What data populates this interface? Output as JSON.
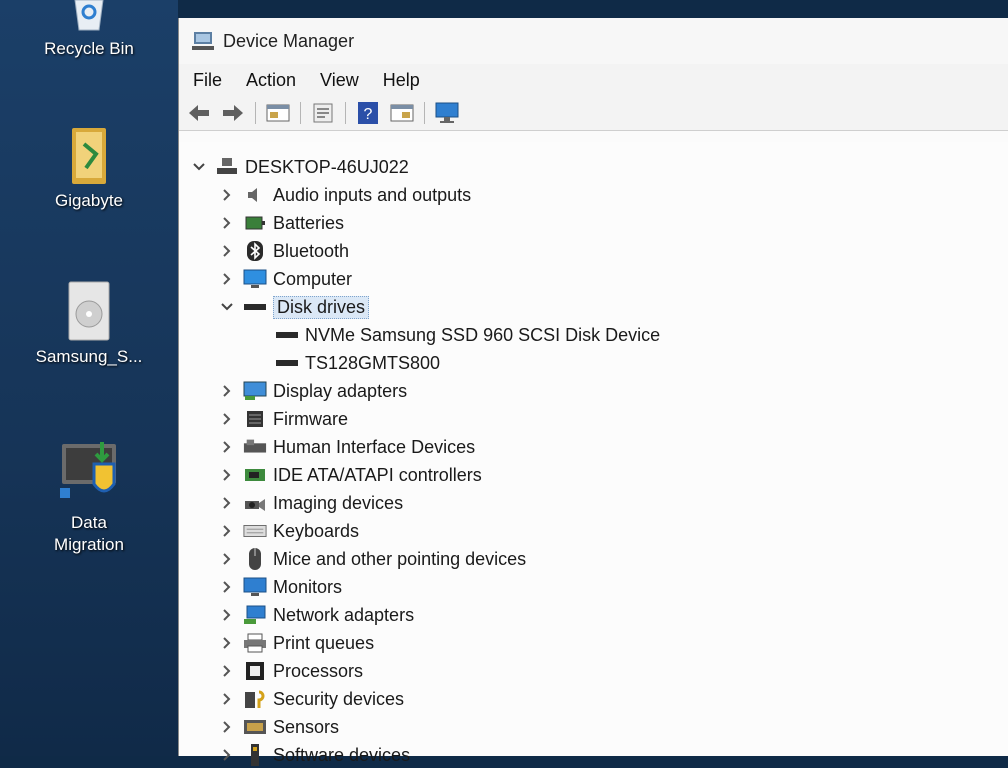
{
  "desktop": {
    "icons": [
      {
        "label": "Recycle Bin",
        "icon": "recycle-bin-icon"
      },
      {
        "label": "Gigabyte",
        "icon": "folder-icon"
      },
      {
        "label": "Samsung_S...",
        "icon": "disc-file-icon"
      },
      {
        "label_line1": "Data",
        "label_line2": "Migration",
        "icon": "data-migration-icon"
      }
    ]
  },
  "window": {
    "title": "Device Manager",
    "menu": [
      "File",
      "Action",
      "View",
      "Help"
    ],
    "toolbar": [
      "back-icon",
      "forward-icon",
      "properties-icon",
      "update-driver-icon",
      "help-icon",
      "action-view-icon",
      "monitor-icon"
    ]
  },
  "tree": {
    "root": "DESKTOP-46UJ022",
    "categories": [
      {
        "label": "Audio inputs and outputs",
        "icon": "speaker-icon",
        "expanded": false
      },
      {
        "label": "Batteries",
        "icon": "battery-icon",
        "expanded": false
      },
      {
        "label": "Bluetooth",
        "icon": "bluetooth-icon",
        "expanded": false
      },
      {
        "label": "Computer",
        "icon": "computer-icon",
        "expanded": false
      },
      {
        "label": "Disk drives",
        "icon": "disk-drive-icon",
        "expanded": true,
        "selected": true,
        "children": [
          "NVMe Samsung SSD 960 SCSI Disk Device",
          "TS128GMTS800"
        ]
      },
      {
        "label": "Display adapters",
        "icon": "display-adapter-icon",
        "expanded": false
      },
      {
        "label": "Firmware",
        "icon": "firmware-icon",
        "expanded": false
      },
      {
        "label": "Human Interface Devices",
        "icon": "hid-icon",
        "expanded": false
      },
      {
        "label": "IDE ATA/ATAPI controllers",
        "icon": "ide-controller-icon",
        "expanded": false
      },
      {
        "label": "Imaging devices",
        "icon": "camera-icon",
        "expanded": false
      },
      {
        "label": "Keyboards",
        "icon": "keyboard-icon",
        "expanded": false
      },
      {
        "label": "Mice and other pointing devices",
        "icon": "mouse-icon",
        "expanded": false
      },
      {
        "label": "Monitors",
        "icon": "monitor-icon",
        "expanded": false
      },
      {
        "label": "Network adapters",
        "icon": "network-adapter-icon",
        "expanded": false
      },
      {
        "label": "Print queues",
        "icon": "printer-icon",
        "expanded": false
      },
      {
        "label": "Processors",
        "icon": "processor-icon",
        "expanded": false
      },
      {
        "label": "Security devices",
        "icon": "security-device-icon",
        "expanded": false
      },
      {
        "label": "Sensors",
        "icon": "sensor-icon",
        "expanded": false
      },
      {
        "label": "Software devices",
        "icon": "software-device-icon",
        "expanded": false
      }
    ]
  }
}
